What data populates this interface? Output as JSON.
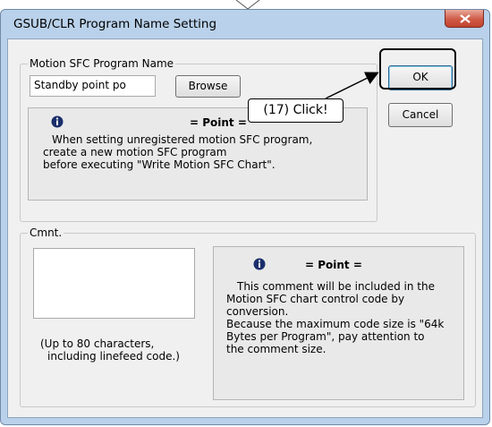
{
  "window": {
    "title": "GSUB/CLR Program Name Setting"
  },
  "program_group": {
    "legend": "Motion SFC Program Name",
    "name_value": "Standby point po",
    "browse_label": "Browse"
  },
  "buttons": {
    "ok_label": "OK",
    "cancel_label": "Cancel"
  },
  "point1": {
    "title": "= Point =",
    "lines": [
      "When setting unregistered motion SFC program,",
      "create a new motion SFC program",
      "before executing \"Write Motion SFC Chart\"."
    ]
  },
  "comment_group": {
    "legend": "Cmnt.",
    "comment_value": "",
    "limit_lines": [
      "(Up to 80 characters,",
      "including linefeed code.)"
    ]
  },
  "point2": {
    "title": "= Point =",
    "lines": [
      "This comment will be included in the",
      "Motion SFC chart control code by",
      "conversion.",
      "Because the maximum code size is \"64k",
      "Bytes per Program\", pay attention to",
      "the comment size."
    ]
  },
  "annotation": {
    "callout_text": "(17) Click!"
  }
}
